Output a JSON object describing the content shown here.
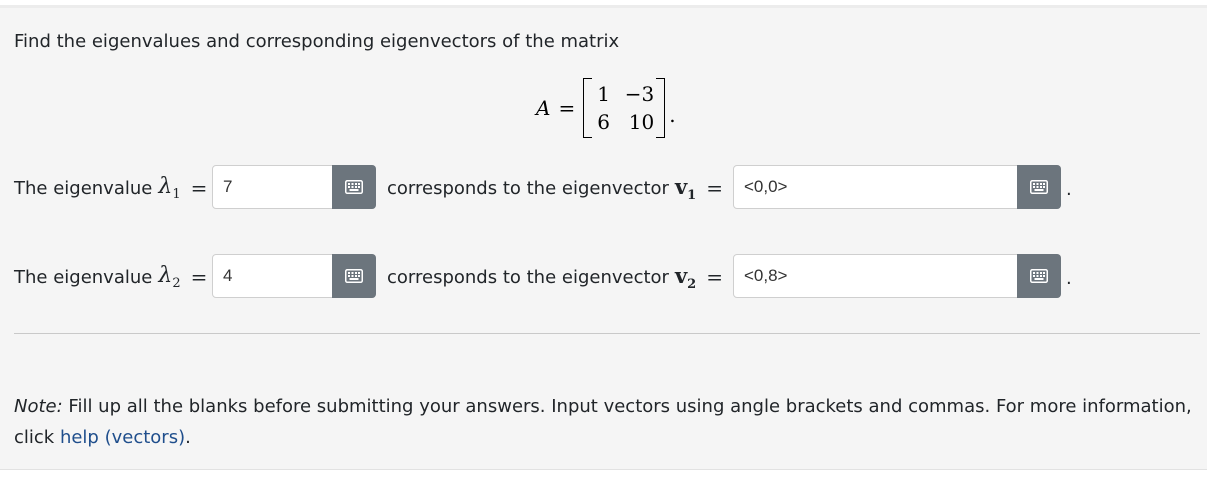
{
  "question": {
    "text": "Find the eigenvalues and corresponding eigenvectors of the matrix",
    "matrix": {
      "name": "A",
      "equals": "=",
      "rows": [
        [
          "1",
          "−3"
        ],
        [
          "6",
          "10"
        ]
      ],
      "trailing": "."
    }
  },
  "rows": [
    {
      "label_prefix": "The eigenvalue",
      "lambda_symbol": "λ",
      "lambda_subscript": "1",
      "equals": "=",
      "eigenvalue_value": "7",
      "middle_text": "corresponds to the eigenvector",
      "vector_symbol": "v",
      "vector_subscript": "1",
      "vector_equals": "=",
      "eigenvector_value": "<0,0>",
      "trailing": "."
    },
    {
      "label_prefix": "The eigenvalue",
      "lambda_symbol": "λ",
      "lambda_subscript": "2",
      "equals": "=",
      "eigenvalue_value": "4",
      "middle_text": "corresponds to the eigenvector",
      "vector_symbol": "v",
      "vector_subscript": "2",
      "vector_equals": "=",
      "eigenvector_value": "<0,8>",
      "trailing": "."
    }
  ],
  "note": {
    "label": "Note:",
    "text": " Fill up all the blanks before submitting your answers. Input vectors using angle brackets and commas. For more information, click ",
    "link_text": "help (vectors)",
    "end": "."
  },
  "icons": {
    "keyboard_button": "keyboard-icon"
  },
  "colors": {
    "panel_bg": "#f5f5f5",
    "keyboard_button_bg": "#6c757d",
    "link": "#1f4e8c"
  }
}
